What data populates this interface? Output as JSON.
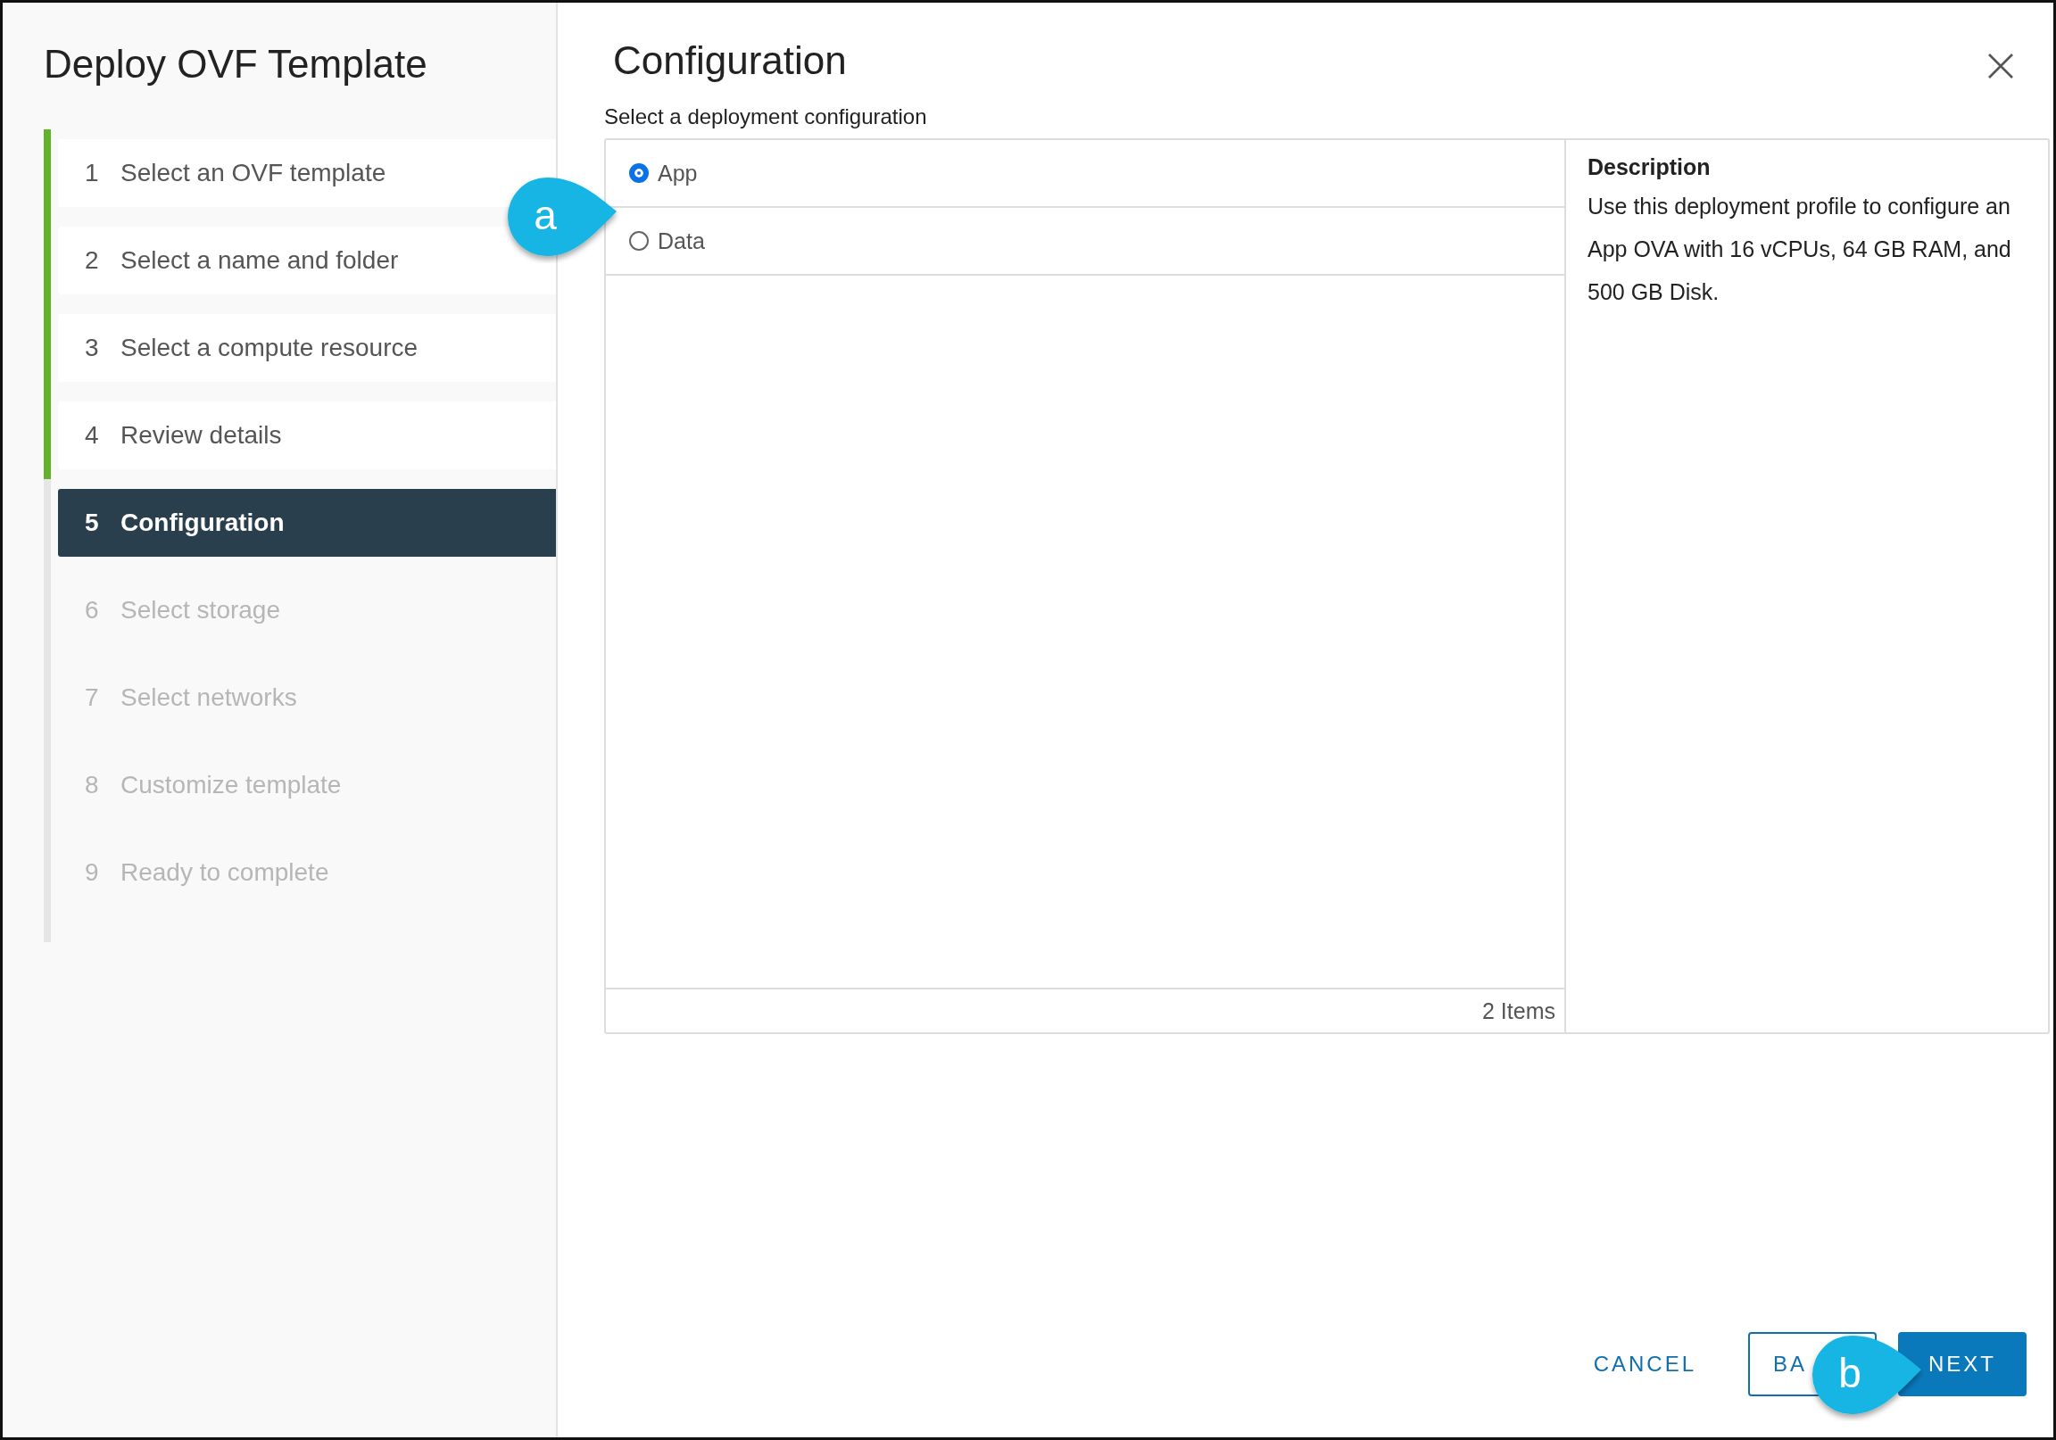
{
  "wizard": {
    "title": "Deploy OVF Template"
  },
  "steps": [
    {
      "number": "1",
      "label": "Select an OVF template",
      "completed": true,
      "selected": false,
      "disabled": false
    },
    {
      "number": "2",
      "label": "Select a name and folder",
      "completed": true,
      "selected": false,
      "disabled": false
    },
    {
      "number": "3",
      "label": "Select a compute resource",
      "completed": true,
      "selected": false,
      "disabled": false
    },
    {
      "number": "4",
      "label": "Review details",
      "completed": true,
      "selected": false,
      "disabled": false
    },
    {
      "number": "5",
      "label": "Configuration",
      "completed": false,
      "selected": true,
      "disabled": false
    },
    {
      "number": "6",
      "label": "Select storage",
      "completed": false,
      "selected": false,
      "disabled": true
    },
    {
      "number": "7",
      "label": "Select networks",
      "completed": false,
      "selected": false,
      "disabled": true
    },
    {
      "number": "8",
      "label": "Customize template",
      "completed": false,
      "selected": false,
      "disabled": true
    },
    {
      "number": "9",
      "label": "Ready to complete",
      "completed": false,
      "selected": false,
      "disabled": true
    }
  ],
  "page": {
    "title": "Configuration",
    "subtitle": "Select a deployment configuration"
  },
  "options": [
    {
      "label": "App",
      "selected": true
    },
    {
      "label": "Data",
      "selected": false
    }
  ],
  "footer": {
    "count": "2 Items"
  },
  "description": {
    "heading": "Description",
    "text": "Use this deployment profile to configure an App OVA with 16 vCPUs, 64 GB RAM, and 500 GB Disk."
  },
  "buttons": [
    {
      "kind": "flat",
      "label": "CANCEL"
    },
    {
      "kind": "outline",
      "label": "BA"
    },
    {
      "kind": "primary",
      "label": "NEXT"
    }
  ],
  "callouts": [
    {
      "letter": "a"
    },
    {
      "letter": "b"
    }
  ]
}
